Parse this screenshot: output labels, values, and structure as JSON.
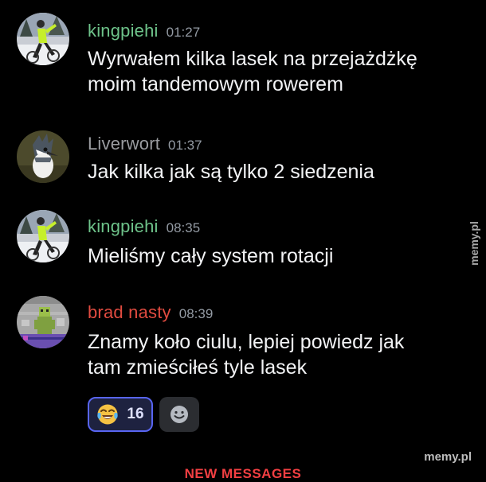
{
  "colors": {
    "background": "#000000",
    "username_green": "#6ec38a",
    "username_gray": "#9a9ca0",
    "username_red": "#e14b40",
    "timestamp": "#949ba4",
    "reaction_border": "#5865f2",
    "new_messages": "#f23f42"
  },
  "messages": [
    {
      "username": "kingpiehi",
      "timestamp": "01:27",
      "lines": [
        "Wyrwałem kilka lasek na przejażdżkę",
        "moim tandemowym rowerem"
      ],
      "avatar": "snowy-cyclist-avatar"
    },
    {
      "username": "Liverwort",
      "timestamp": "01:37",
      "lines": [
        "Jak kilka jak są tylko 2 siedzenia"
      ],
      "avatar": "kingfisher-bird-avatar"
    },
    {
      "username": "kingpiehi",
      "timestamp": "08:35",
      "lines": [
        "Mieliśmy cały system rotacji"
      ],
      "avatar": "snowy-cyclist-avatar"
    },
    {
      "username": "brad nasty",
      "timestamp": "08:39",
      "lines": [
        "Znamy koło ciulu, lepiej powiedz jak",
        "tam zmieściłeś tyle lasek"
      ],
      "avatar": "pixel-art-avatar"
    }
  ],
  "reactions": [
    {
      "emoji": "joy-tears-emoji",
      "count": "16"
    }
  ],
  "add_reaction_icon": "smiley-add-icon",
  "watermark_side": "memy.pl",
  "watermark_bottom": "memy.pl",
  "new_messages_label": "NEW MESSAGES"
}
